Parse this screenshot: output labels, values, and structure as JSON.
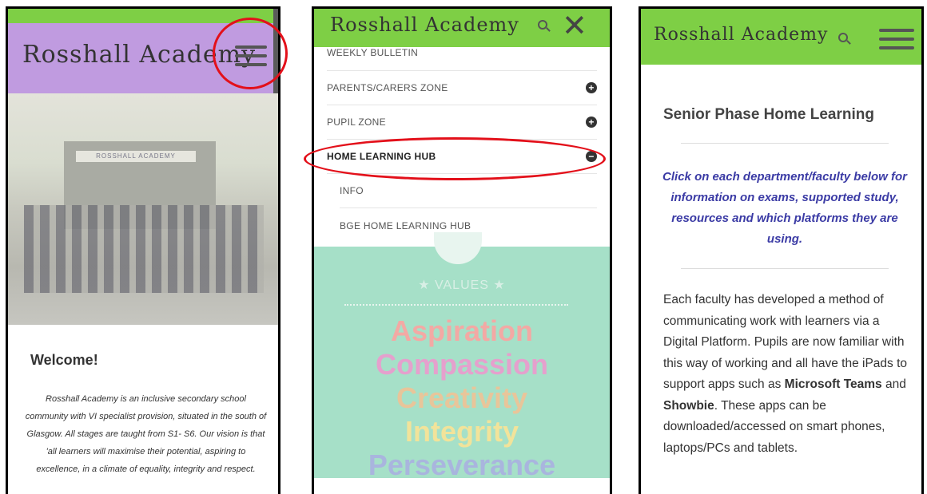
{
  "panel1": {
    "brand": "Rosshall Academy",
    "photo_sign": "ROSSHALL ACADEMY",
    "welcome_title": "Welcome!",
    "intro": "Rosshall Academy is an inclusive secondary school community with VI specialist provision, situated in the south of Glasgow. All stages are taught from S1- S6. Our vision is that 'all learners will maximise their potential, aspiring to excellence, in a climate of equality, integrity and respect."
  },
  "panel2": {
    "brand": "Rosshall Academy",
    "close": "✕",
    "menu": [
      {
        "label": "WEEKLY BULLETIN"
      },
      {
        "label": "PARENTS/CARERS ZONE",
        "toggle": "+"
      },
      {
        "label": "PUPIL ZONE",
        "toggle": "+"
      },
      {
        "label": "HOME LEARNING HUB",
        "toggle": "−"
      },
      {
        "label": "INFO"
      },
      {
        "label": "BGE HOME LEARNING HUB"
      }
    ],
    "values_title": "VALUES",
    "values": [
      {
        "word": "Aspiration",
        "color": "#f3a9a4"
      },
      {
        "word": "Compassion",
        "color": "#e5a0cd"
      },
      {
        "word": "Creativity",
        "color": "#e8c59a"
      },
      {
        "word": "Integrity",
        "color": "#f2e39a"
      },
      {
        "word": "Perseverance",
        "color": "#a9b5de"
      }
    ]
  },
  "panel3": {
    "brand": "Rosshall Academy",
    "title": "Senior Phase Home Learning",
    "italic": "Click on each department/faculty below for information on exams, supported study, resources and which platforms they are using.",
    "body_1": "Each faculty has developed a method of communicating work with learners via a Digital Platform. Pupils are now familiar with this way of working and all have the iPads to support apps such as ",
    "body_bold_1": "Microsoft Teams",
    "body_2": " and ",
    "body_bold_2": "Showbie",
    "body_3": ". These apps can be downloaded/accessed on smart phones, laptops/PCs and tablets."
  },
  "colors": {
    "green": "#7ecf45",
    "purple": "#c09be0",
    "mint": "#a6e0c8",
    "highlight_red": "#e3101a",
    "italic_blue": "#3b3ba5"
  }
}
